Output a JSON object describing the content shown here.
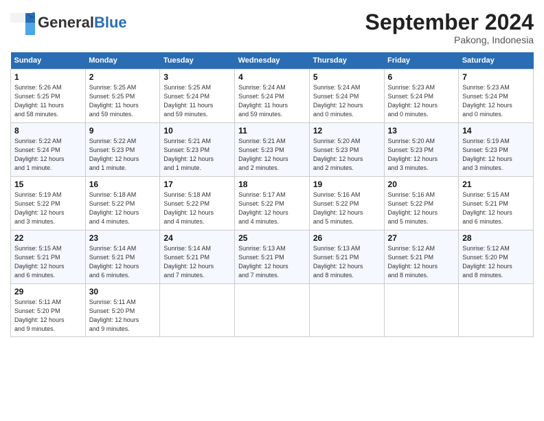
{
  "header": {
    "logo_general": "General",
    "logo_blue": "Blue",
    "month": "September 2024",
    "location": "Pakong, Indonesia"
  },
  "days_of_week": [
    "Sunday",
    "Monday",
    "Tuesday",
    "Wednesday",
    "Thursday",
    "Friday",
    "Saturday"
  ],
  "weeks": [
    [
      {
        "day": "1",
        "info": "Sunrise: 5:26 AM\nSunset: 5:25 PM\nDaylight: 11 hours\nand 58 minutes."
      },
      {
        "day": "2",
        "info": "Sunrise: 5:25 AM\nSunset: 5:25 PM\nDaylight: 11 hours\nand 59 minutes."
      },
      {
        "day": "3",
        "info": "Sunrise: 5:25 AM\nSunset: 5:24 PM\nDaylight: 11 hours\nand 59 minutes."
      },
      {
        "day": "4",
        "info": "Sunrise: 5:24 AM\nSunset: 5:24 PM\nDaylight: 11 hours\nand 59 minutes."
      },
      {
        "day": "5",
        "info": "Sunrise: 5:24 AM\nSunset: 5:24 PM\nDaylight: 12 hours\nand 0 minutes."
      },
      {
        "day": "6",
        "info": "Sunrise: 5:23 AM\nSunset: 5:24 PM\nDaylight: 12 hours\nand 0 minutes."
      },
      {
        "day": "7",
        "info": "Sunrise: 5:23 AM\nSunset: 5:24 PM\nDaylight: 12 hours\nand 0 minutes."
      }
    ],
    [
      {
        "day": "8",
        "info": "Sunrise: 5:22 AM\nSunset: 5:24 PM\nDaylight: 12 hours\nand 1 minute."
      },
      {
        "day": "9",
        "info": "Sunrise: 5:22 AM\nSunset: 5:23 PM\nDaylight: 12 hours\nand 1 minute."
      },
      {
        "day": "10",
        "info": "Sunrise: 5:21 AM\nSunset: 5:23 PM\nDaylight: 12 hours\nand 1 minute."
      },
      {
        "day": "11",
        "info": "Sunrise: 5:21 AM\nSunset: 5:23 PM\nDaylight: 12 hours\nand 2 minutes."
      },
      {
        "day": "12",
        "info": "Sunrise: 5:20 AM\nSunset: 5:23 PM\nDaylight: 12 hours\nand 2 minutes."
      },
      {
        "day": "13",
        "info": "Sunrise: 5:20 AM\nSunset: 5:23 PM\nDaylight: 12 hours\nand 3 minutes."
      },
      {
        "day": "14",
        "info": "Sunrise: 5:19 AM\nSunset: 5:23 PM\nDaylight: 12 hours\nand 3 minutes."
      }
    ],
    [
      {
        "day": "15",
        "info": "Sunrise: 5:19 AM\nSunset: 5:22 PM\nDaylight: 12 hours\nand 3 minutes."
      },
      {
        "day": "16",
        "info": "Sunrise: 5:18 AM\nSunset: 5:22 PM\nDaylight: 12 hours\nand 4 minutes."
      },
      {
        "day": "17",
        "info": "Sunrise: 5:18 AM\nSunset: 5:22 PM\nDaylight: 12 hours\nand 4 minutes."
      },
      {
        "day": "18",
        "info": "Sunrise: 5:17 AM\nSunset: 5:22 PM\nDaylight: 12 hours\nand 4 minutes."
      },
      {
        "day": "19",
        "info": "Sunrise: 5:16 AM\nSunset: 5:22 PM\nDaylight: 12 hours\nand 5 minutes."
      },
      {
        "day": "20",
        "info": "Sunrise: 5:16 AM\nSunset: 5:22 PM\nDaylight: 12 hours\nand 5 minutes."
      },
      {
        "day": "21",
        "info": "Sunrise: 5:15 AM\nSunset: 5:21 PM\nDaylight: 12 hours\nand 6 minutes."
      }
    ],
    [
      {
        "day": "22",
        "info": "Sunrise: 5:15 AM\nSunset: 5:21 PM\nDaylight: 12 hours\nand 6 minutes."
      },
      {
        "day": "23",
        "info": "Sunrise: 5:14 AM\nSunset: 5:21 PM\nDaylight: 12 hours\nand 6 minutes."
      },
      {
        "day": "24",
        "info": "Sunrise: 5:14 AM\nSunset: 5:21 PM\nDaylight: 12 hours\nand 7 minutes."
      },
      {
        "day": "25",
        "info": "Sunrise: 5:13 AM\nSunset: 5:21 PM\nDaylight: 12 hours\nand 7 minutes."
      },
      {
        "day": "26",
        "info": "Sunrise: 5:13 AM\nSunset: 5:21 PM\nDaylight: 12 hours\nand 8 minutes."
      },
      {
        "day": "27",
        "info": "Sunrise: 5:12 AM\nSunset: 5:21 PM\nDaylight: 12 hours\nand 8 minutes."
      },
      {
        "day": "28",
        "info": "Sunrise: 5:12 AM\nSunset: 5:20 PM\nDaylight: 12 hours\nand 8 minutes."
      }
    ],
    [
      {
        "day": "29",
        "info": "Sunrise: 5:11 AM\nSunset: 5:20 PM\nDaylight: 12 hours\nand 9 minutes."
      },
      {
        "day": "30",
        "info": "Sunrise: 5:11 AM\nSunset: 5:20 PM\nDaylight: 12 hours\nand 9 minutes."
      },
      {
        "day": "",
        "info": ""
      },
      {
        "day": "",
        "info": ""
      },
      {
        "day": "",
        "info": ""
      },
      {
        "day": "",
        "info": ""
      },
      {
        "day": "",
        "info": ""
      }
    ]
  ]
}
